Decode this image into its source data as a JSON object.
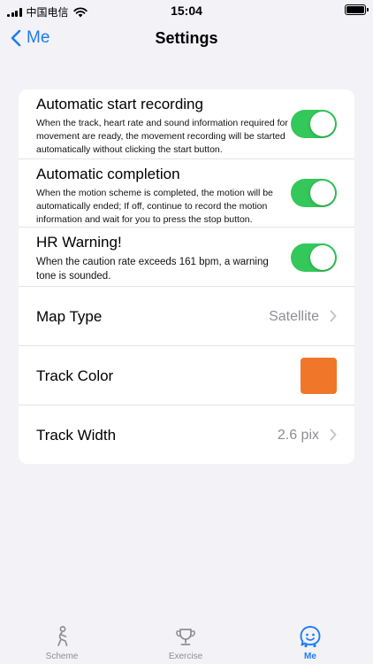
{
  "status_bar": {
    "carrier": "中国电信",
    "time": "15:04"
  },
  "nav": {
    "back_label": "Me",
    "title": "Settings"
  },
  "settings": {
    "auto_start": {
      "title": "Automatic start recording",
      "description": "When the track, heart rate and sound information required for movement are ready, the movement recording will be started automatically without clicking the start button.",
      "enabled": true
    },
    "auto_complete": {
      "title": "Automatic completion",
      "description": "When the motion scheme is completed, the motion will be automatically ended; If off, continue to record the motion information and wait for you to press the stop button.",
      "enabled": true
    },
    "hr_warning": {
      "title": "HR Warning!",
      "description": "When the caution rate exceeds 161 bpm, a warning tone is sounded.",
      "enabled": true
    },
    "map_type": {
      "label": "Map Type",
      "value": "Satellite"
    },
    "track_color": {
      "label": "Track Color",
      "color": "#f0762a"
    },
    "track_width": {
      "label": "Track Width",
      "value": "2.6 pix"
    }
  },
  "tabs": [
    {
      "label": "Scheme",
      "icon": "runner-icon",
      "active": false
    },
    {
      "label": "Exercise",
      "icon": "trophy-icon",
      "active": false
    },
    {
      "label": "Me",
      "icon": "smiley-badge-icon",
      "active": true
    }
  ],
  "colors": {
    "accent": "#1e7cf6",
    "toggle_on": "#34c759",
    "background": "#f2f2f7"
  }
}
